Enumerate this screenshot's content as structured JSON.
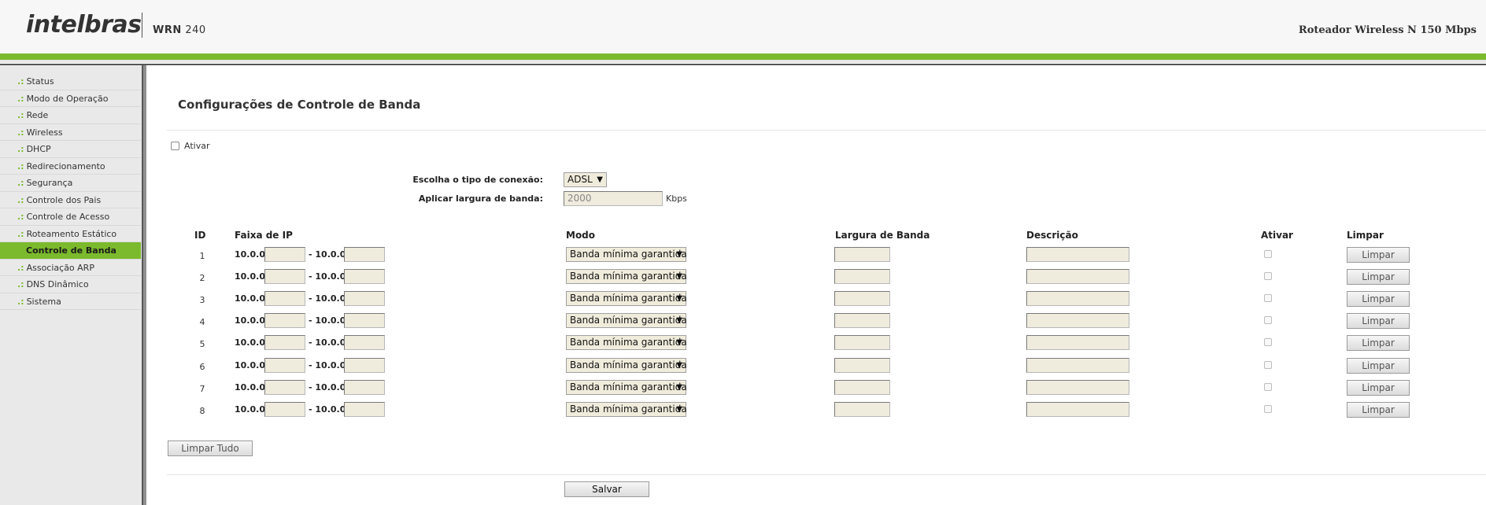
{
  "header": {
    "logo": "intelbras",
    "model_prefix": "WRN",
    "model_number": "240",
    "product": "Roteador Wireless N 150 Mbps"
  },
  "sidebar": {
    "bullet": ".:",
    "items": [
      {
        "label": "Status"
      },
      {
        "label": "Modo de Operação"
      },
      {
        "label": "Rede"
      },
      {
        "label": "Wireless"
      },
      {
        "label": "DHCP"
      },
      {
        "label": "Redirecionamento"
      },
      {
        "label": "Segurança"
      },
      {
        "label": "Controle dos Pais"
      },
      {
        "label": "Controle de Acesso"
      },
      {
        "label": "Roteamento Estático"
      },
      {
        "label": "Controle de Banda",
        "active": true
      },
      {
        "label": "Associação ARP"
      },
      {
        "label": "DNS Dinâmico"
      },
      {
        "label": "Sistema"
      }
    ]
  },
  "page": {
    "title": "Configurações de Controle de Banda",
    "enable_label": "Ativar",
    "connection_label": "Escolha o tipo de conexão:",
    "connection_value": "ADSL",
    "bandwidth_label": "Aplicar largura de banda:",
    "bandwidth_value": "2000",
    "bandwidth_unit": "Kbps"
  },
  "table": {
    "headers": {
      "id": "ID",
      "ip_range": "Faixa de IP",
      "mode": "Modo",
      "bandwidth": "Largura de Banda",
      "description": "Descrição",
      "enable": "Ativar",
      "clear": "Limpar"
    },
    "ip_prefix": "10.0.0.",
    "ip_separator": "- 10.0.0.",
    "rows": [
      {
        "id": "1",
        "mode": "Banda mínima garantida",
        "clear_label": "Limpar"
      },
      {
        "id": "2",
        "mode": "Banda mínima garantida",
        "clear_label": "Limpar"
      },
      {
        "id": "3",
        "mode": "Banda mínima garantida",
        "clear_label": "Limpar"
      },
      {
        "id": "4",
        "mode": "Banda mínima garantida",
        "clear_label": "Limpar"
      },
      {
        "id": "5",
        "mode": "Banda mínima garantida",
        "clear_label": "Limpar"
      },
      {
        "id": "6",
        "mode": "Banda mínima garantida",
        "clear_label": "Limpar"
      },
      {
        "id": "7",
        "mode": "Banda mínima garantida",
        "clear_label": "Limpar"
      },
      {
        "id": "8",
        "mode": "Banda mínima garantida",
        "clear_label": "Limpar"
      }
    ]
  },
  "buttons": {
    "clear_all": "Limpar Tudo",
    "save": "Salvar"
  },
  "colors": {
    "accent": "#7bba2d",
    "input_bg": "#efebdd"
  }
}
